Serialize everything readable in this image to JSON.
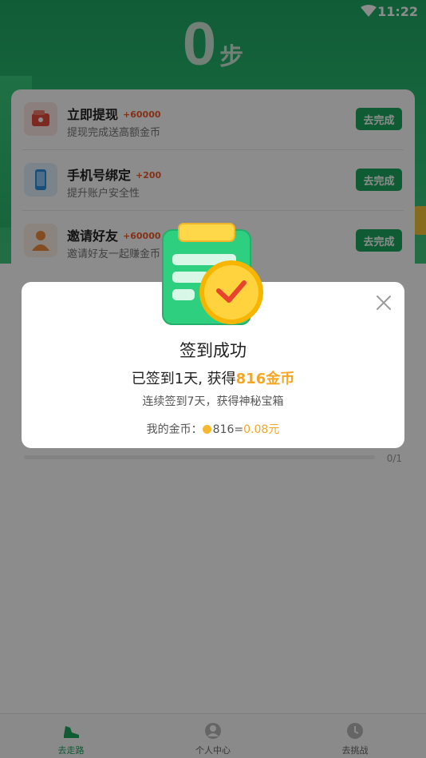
{
  "status": {
    "time": "11:22"
  },
  "steps": {
    "count": "0",
    "unit": "步"
  },
  "tasks": [
    {
      "title": "立即提现",
      "reward": "+60000",
      "desc": "提现完成送高额金币",
      "button": "去完成",
      "icon": "wallet-icon",
      "icon_bg": "#fde8e6"
    },
    {
      "title": "手机号绑定",
      "reward": "+200",
      "desc": "提升账户安全性",
      "button": "去完成",
      "icon": "phone-icon",
      "icon_bg": "#e2f0fd"
    },
    {
      "title": "邀请好友",
      "reward": "+60000",
      "desc": "邀请好友一起赚金币",
      "button": "去完成",
      "icon": "friends-icon",
      "icon_bg": "#fdeee3"
    }
  ],
  "progress": {
    "text": "0/1",
    "value": 0
  },
  "dialog": {
    "title": "签到成功",
    "line_prefix": "已签到1天, 获得",
    "line_highlight": "816金币",
    "subtitle": "连续签到7天，获得神秘宝箱",
    "coins_label": "我的金币：",
    "coins_value": "816",
    "equals": "=",
    "yuan_value": "0.08元",
    "close_icon": "close-icon"
  },
  "nav": [
    {
      "label": "去走路",
      "icon": "shoe-icon",
      "active": true
    },
    {
      "label": "个人中心",
      "icon": "user-icon",
      "active": false
    },
    {
      "label": "去挑战",
      "icon": "challenge-icon",
      "active": false
    }
  ],
  "colors": {
    "brand_green": "#1aa660",
    "accent_orange": "#f5a623",
    "reward_red": "#f05a28"
  }
}
